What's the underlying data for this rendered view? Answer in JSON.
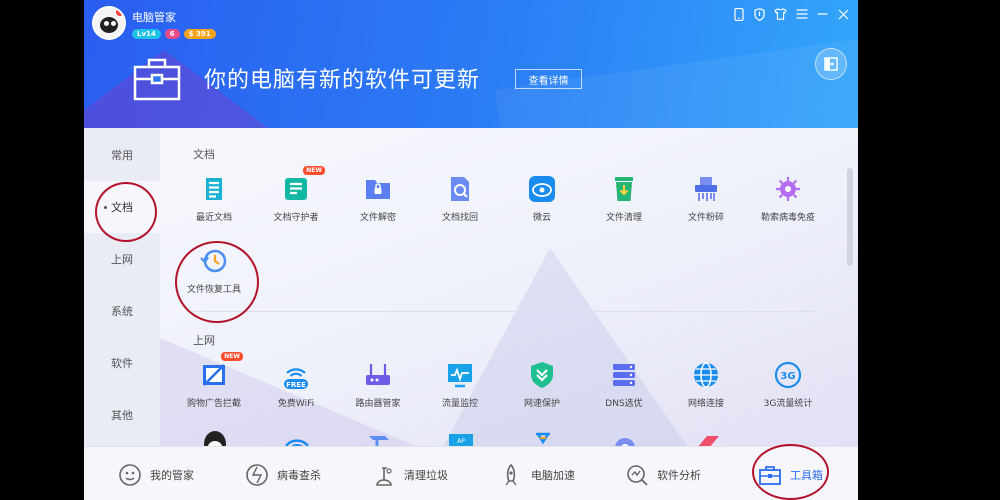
{
  "header": {
    "username": "电脑管家",
    "badges": [
      "Lv14",
      "6",
      "$ 391"
    ],
    "headline": "你的电脑有新的软件可更新",
    "detail_button": "查看详情"
  },
  "nav": {
    "items": [
      {
        "label": "常用"
      },
      {
        "label": "文档"
      },
      {
        "label": "上网"
      },
      {
        "label": "系统"
      },
      {
        "label": "软件"
      },
      {
        "label": "其他"
      }
    ],
    "active": "文档"
  },
  "sections": [
    {
      "title": "文档",
      "tools": [
        {
          "label": "最近文档",
          "icon": "recent-docs-icon"
        },
        {
          "label": "文档守护者",
          "icon": "doc-guardian-icon",
          "tag": "NEW"
        },
        {
          "label": "文件解密",
          "icon": "file-decrypt-icon"
        },
        {
          "label": "文档找回",
          "icon": "doc-recover-icon"
        },
        {
          "label": "微云",
          "icon": "weiyun-icon"
        },
        {
          "label": "文件清理",
          "icon": "file-clean-icon"
        },
        {
          "label": "文件粉碎",
          "icon": "file-shred-icon"
        },
        {
          "label": "勒索病毒免疫",
          "icon": "ransomware-immune-icon"
        },
        {
          "label": "文件恢复工具",
          "icon": "file-restore-icon"
        }
      ]
    },
    {
      "title": "上网",
      "tools": [
        {
          "label": "购物广告拦截",
          "icon": "ad-block-icon",
          "tag": "NEW"
        },
        {
          "label": "免费WiFi",
          "icon": "free-wifi-icon",
          "icon_text": "FREE"
        },
        {
          "label": "路由器管家",
          "icon": "router-icon"
        },
        {
          "label": "流量监控",
          "icon": "traffic-monitor-icon"
        },
        {
          "label": "网速保护",
          "icon": "speed-protect-icon"
        },
        {
          "label": "DNS选优",
          "icon": "dns-icon"
        },
        {
          "label": "网络连接",
          "icon": "network-globe-icon"
        },
        {
          "label": "3G流量统计",
          "icon": "3g-stats-icon",
          "icon_text": "3G"
        }
      ]
    }
  ],
  "bottom_tabs": [
    {
      "label": "我的管家",
      "icon": "my-manager-icon"
    },
    {
      "label": "病毒查杀",
      "icon": "virus-scan-icon"
    },
    {
      "label": "清理垃圾",
      "icon": "cleanup-icon"
    },
    {
      "label": "电脑加速",
      "icon": "rocket-icon"
    },
    {
      "label": "软件分析",
      "icon": "software-analysis-icon"
    },
    {
      "label": "工具箱",
      "icon": "toolbox-icon"
    }
  ],
  "colors": {
    "accent": "#2b6df2",
    "header_start": "#2a5df0",
    "header_end": "#33a6fb",
    "annotation": "#b3122b"
  }
}
